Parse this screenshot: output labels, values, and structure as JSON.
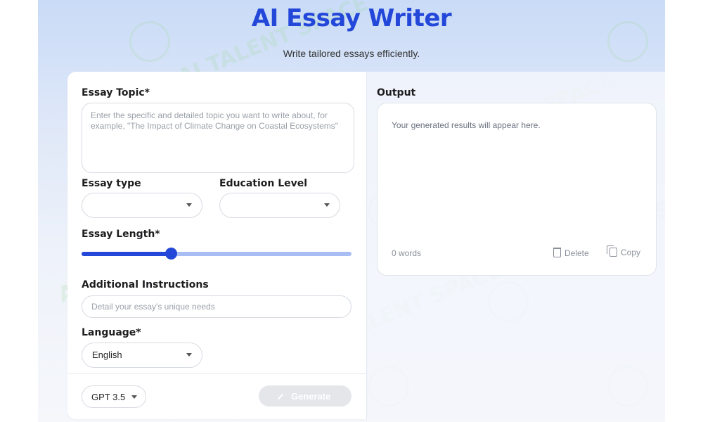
{
  "header": {
    "title": "AI Essay Writer",
    "subtitle": "Write tailored essays efficiently."
  },
  "form": {
    "topic_label": "Essay Topic*",
    "topic_placeholder": "Enter the specific and detailed topic you want to write about, for example, \"The Impact of Climate Change on Coastal Ecosystems\"",
    "type_label": "Essay type",
    "type_value": "",
    "education_label": "Education Level",
    "education_value": "",
    "length_label": "Essay Length*",
    "length_fraction": 0.33,
    "instructions_label": "Additional Instructions",
    "instructions_placeholder": "Detail your essay's unique needs",
    "language_label": "Language*",
    "language_value": "English"
  },
  "footer": {
    "model_value": "GPT 3.5",
    "generate_label": "Generate"
  },
  "output": {
    "label": "Output",
    "placeholder": "Your generated results will appear here.",
    "word_count": "0 words",
    "delete_label": "Delete",
    "copy_label": "Copy"
  },
  "watermark_text": "AI TALENT SPACE",
  "colors": {
    "accent": "#2347d9",
    "slider_track": "#a9bdf5",
    "generate_disabled": "#e4e6ea",
    "watermark": "#a0dca0"
  }
}
